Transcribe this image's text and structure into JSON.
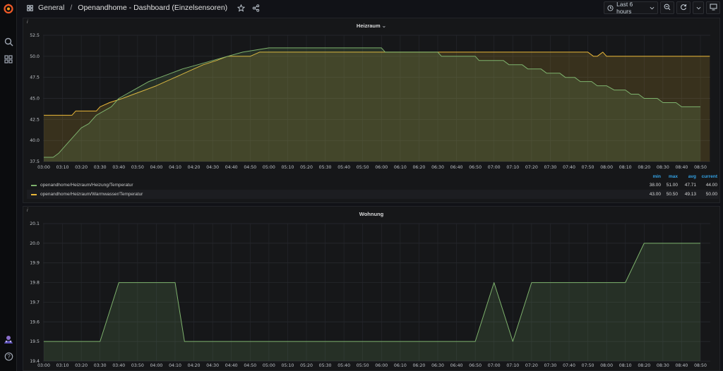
{
  "header": {
    "folder": "General",
    "separator": "/",
    "dashboard_title": "Openandhome - Dashboard (Einzelsensoren)",
    "time_range_label": "Last 6 hours",
    "colors": {
      "accent": "#33a2e5",
      "brand": "#f05a28"
    }
  },
  "sidebar": {
    "icons": [
      "grafana-logo-icon",
      "search-icon",
      "dashboards-grid-icon",
      "user-avatar-icon",
      "help-icon"
    ]
  },
  "time_axis": [
    "03:00",
    "03:10",
    "03:20",
    "03:30",
    "03:40",
    "03:50",
    "04:00",
    "04:10",
    "04:20",
    "04:30",
    "04:40",
    "04:50",
    "05:00",
    "05:10",
    "05:20",
    "05:30",
    "05:40",
    "05:50",
    "06:00",
    "06:10",
    "06:20",
    "06:30",
    "06:40",
    "06:50",
    "07:00",
    "07:10",
    "07:20",
    "07:30",
    "07:40",
    "07:50",
    "08:00",
    "08:10",
    "08:20",
    "08:30",
    "08:40",
    "08:50"
  ],
  "panels": [
    {
      "title": "Heizraum",
      "info": "i",
      "legend": {
        "headers": [
          "min",
          "max",
          "avg",
          "current"
        ],
        "rows": [
          {
            "name": "openandhome/Heizraum/Heizung/Temperatur",
            "min": "38.00",
            "max": "51.00",
            "avg": "47.71",
            "current": "44.00",
            "color": "#7eb26d"
          },
          {
            "name": "openandhome/Heizraum/Warmwasser/Temperatur",
            "min": "43.00",
            "max": "50.50",
            "avg": "49.13",
            "current": "50.00",
            "color": "#eab839"
          }
        ]
      }
    },
    {
      "title": "Wohnung",
      "info": "i"
    }
  ],
  "chart_data": [
    {
      "type": "line",
      "title": "Heizraum",
      "x_unit": "time (HH:MM)",
      "xlim": [
        "03:00",
        "08:55"
      ],
      "ylim": [
        37.5,
        52.5
      ],
      "y_ticks": [
        37.5,
        40.0,
        42.5,
        45.0,
        47.5,
        50.0,
        52.5
      ],
      "grid": true,
      "legend_placement": "bottom",
      "series": [
        {
          "name": "openandhome/Heizraum/Heizung/Temperatur",
          "color": "#7eb26d",
          "points": [
            [
              "03:00",
              38.0
            ],
            [
              "03:05",
              38.0
            ],
            [
              "03:08",
              38.5
            ],
            [
              "03:12",
              39.5
            ],
            [
              "03:16",
              40.5
            ],
            [
              "03:20",
              41.5
            ],
            [
              "03:24",
              42.0
            ],
            [
              "03:28",
              43.0
            ],
            [
              "03:32",
              43.5
            ],
            [
              "03:36",
              44.0
            ],
            [
              "03:40",
              45.0
            ],
            [
              "03:44",
              45.5
            ],
            [
              "03:48",
              46.0
            ],
            [
              "03:52",
              46.5
            ],
            [
              "03:56",
              47.0
            ],
            [
              "04:02",
              47.5
            ],
            [
              "04:08",
              48.0
            ],
            [
              "04:14",
              48.5
            ],
            [
              "04:22",
              49.0
            ],
            [
              "04:30",
              49.5
            ],
            [
              "04:38",
              50.0
            ],
            [
              "04:46",
              50.5
            ],
            [
              "05:00",
              51.0
            ],
            [
              "06:00",
              51.0
            ],
            [
              "06:02",
              50.5
            ],
            [
              "06:30",
              50.5
            ],
            [
              "06:32",
              50.0
            ],
            [
              "06:50",
              50.0
            ],
            [
              "06:52",
              49.5
            ],
            [
              "07:05",
              49.5
            ],
            [
              "07:08",
              49.0
            ],
            [
              "07:15",
              49.0
            ],
            [
              "07:18",
              48.5
            ],
            [
              "07:25",
              48.5
            ],
            [
              "07:28",
              48.0
            ],
            [
              "07:35",
              48.0
            ],
            [
              "07:38",
              47.5
            ],
            [
              "07:43",
              47.5
            ],
            [
              "07:46",
              47.0
            ],
            [
              "07:52",
              47.0
            ],
            [
              "07:55",
              46.5
            ],
            [
              "08:00",
              46.5
            ],
            [
              "08:04",
              46.0
            ],
            [
              "08:10",
              46.0
            ],
            [
              "08:13",
              45.5
            ],
            [
              "08:17",
              45.5
            ],
            [
              "08:20",
              45.0
            ],
            [
              "08:27",
              45.0
            ],
            [
              "08:30",
              44.5
            ],
            [
              "08:37",
              44.5
            ],
            [
              "08:40",
              44.0
            ],
            [
              "08:50",
              44.0
            ]
          ]
        },
        {
          "name": "openandhome/Heizraum/Warmwasser/Temperatur",
          "color": "#eab839",
          "points": [
            [
              "03:00",
              43.0
            ],
            [
              "03:15",
              43.0
            ],
            [
              "03:17",
              43.5
            ],
            [
              "03:28",
              43.5
            ],
            [
              "03:30",
              44.0
            ],
            [
              "03:35",
              44.5
            ],
            [
              "03:42",
              45.0
            ],
            [
              "03:48",
              45.5
            ],
            [
              "03:54",
              46.0
            ],
            [
              "04:00",
              46.5
            ],
            [
              "04:05",
              47.0
            ],
            [
              "04:10",
              47.5
            ],
            [
              "04:15",
              48.0
            ],
            [
              "04:20",
              48.5
            ],
            [
              "04:25",
              49.0
            ],
            [
              "04:32",
              49.5
            ],
            [
              "04:38",
              50.0
            ],
            [
              "04:50",
              50.0
            ],
            [
              "04:55",
              50.5
            ],
            [
              "07:50",
              50.5
            ],
            [
              "07:53",
              50.0
            ],
            [
              "07:55",
              50.0
            ],
            [
              "07:58",
              50.5
            ],
            [
              "08:00",
              50.0
            ],
            [
              "08:55",
              50.0
            ]
          ]
        }
      ]
    },
    {
      "type": "line",
      "title": "Wohnung",
      "x_unit": "time (HH:MM)",
      "xlim": [
        "03:00",
        "08:55"
      ],
      "ylim": [
        19.4,
        20.1
      ],
      "y_ticks": [
        19.4,
        19.5,
        19.6,
        19.7,
        19.8,
        19.9,
        20.0,
        20.1
      ],
      "grid": true,
      "series": [
        {
          "color": "#7eb26d",
          "points": [
            [
              "03:00",
              19.5
            ],
            [
              "03:30",
              19.5
            ],
            [
              "03:40",
              19.8
            ],
            [
              "04:10",
              19.8
            ],
            [
              "04:15",
              19.5
            ],
            [
              "06:50",
              19.5
            ],
            [
              "07:00",
              19.8
            ],
            [
              "07:10",
              19.5
            ],
            [
              "07:20",
              19.8
            ],
            [
              "08:10",
              19.8
            ],
            [
              "08:20",
              20.0
            ],
            [
              "08:50",
              20.0
            ]
          ]
        }
      ]
    }
  ]
}
